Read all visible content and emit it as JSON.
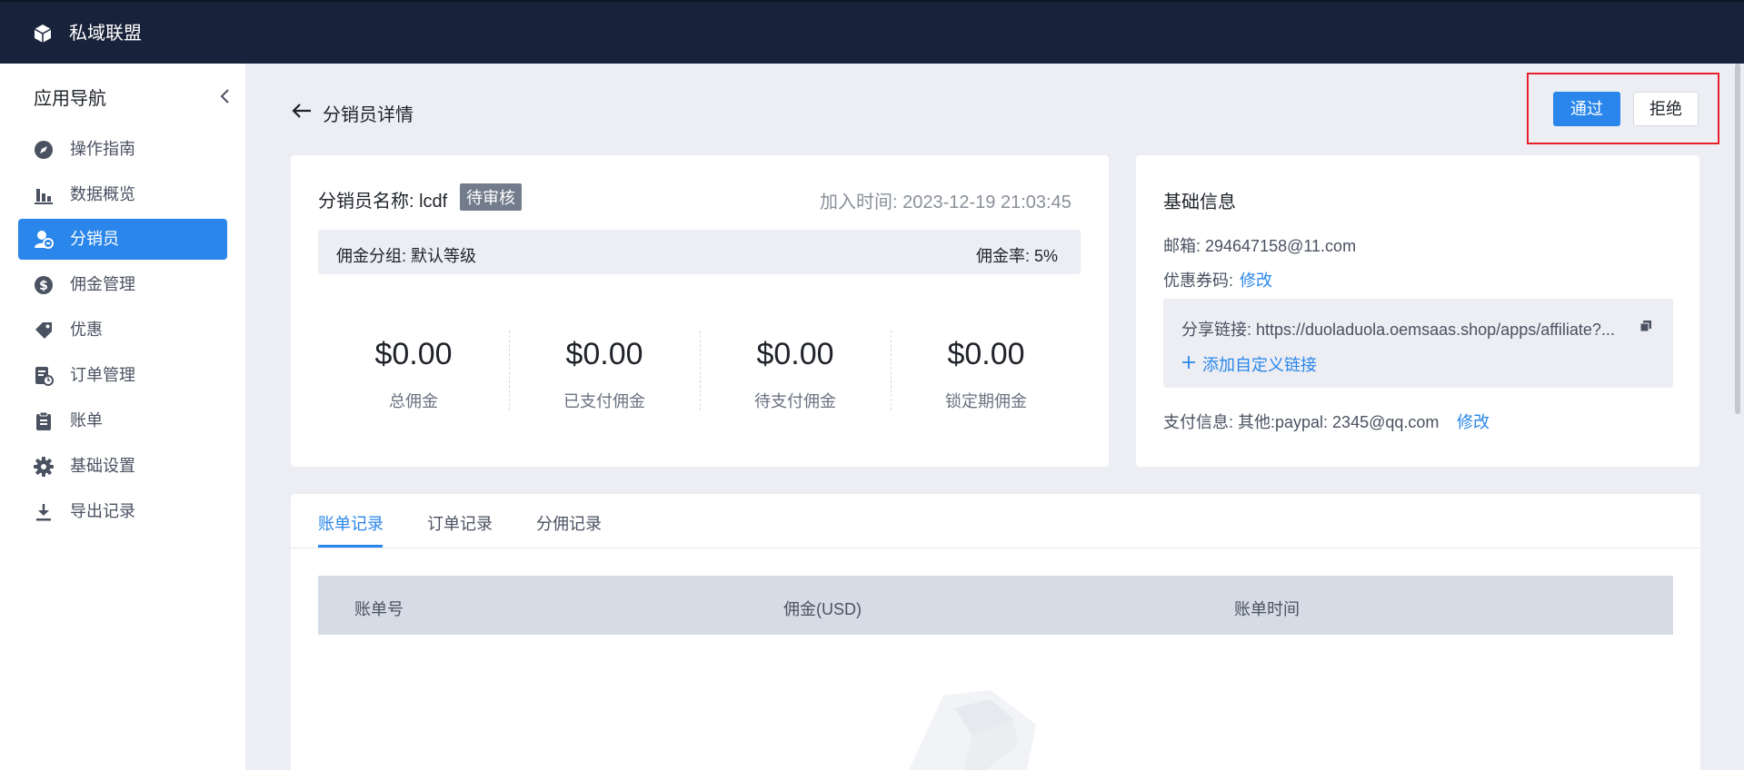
{
  "header": {
    "app_title": "私域联盟",
    "logo_icon": "cube-icon"
  },
  "sidebar": {
    "title": "应用导航",
    "collapse_icon": "chevron-left-icon",
    "items": [
      {
        "label": "操作指南",
        "icon": "compass-icon"
      },
      {
        "label": "数据概览",
        "icon": "bar-chart-icon"
      },
      {
        "label": "分销员",
        "icon": "user-group-icon",
        "active": true
      },
      {
        "label": "佣金管理",
        "icon": "dollar-circle-icon"
      },
      {
        "label": "优惠",
        "icon": "tag-icon"
      },
      {
        "label": "订单管理",
        "icon": "order-icon"
      },
      {
        "label": "账单",
        "icon": "clipboard-icon"
      },
      {
        "label": "基础设置",
        "icon": "gear-icon"
      },
      {
        "label": "导出记录",
        "icon": "download-icon"
      }
    ]
  },
  "page": {
    "title": "分销员详情",
    "approve_label": "通过",
    "reject_label": "拒绝"
  },
  "affiliate": {
    "name_label": "分销员名称: lcdf",
    "status_badge": "待审核",
    "join_time": "加入时间: 2023-12-19 21:03:45",
    "group_label": "佣金分组: 默认等级",
    "rate_label": "佣金率: 5%",
    "stats": [
      {
        "value": "$0.00",
        "label": "总佣金"
      },
      {
        "value": "$0.00",
        "label": "已支付佣金"
      },
      {
        "value": "$0.00",
        "label": "待支付佣金"
      },
      {
        "value": "$0.00",
        "label": "锁定期佣金"
      }
    ]
  },
  "basic_info": {
    "title": "基础信息",
    "email": "邮箱: 294647158@11.com",
    "coupon_label": "优惠券码:",
    "coupon_edit": "修改",
    "share_link": "分享链接: https://duoladuola.oemsaas.shop/apps/affiliate?...",
    "add_custom_link": "添加自定义链接",
    "payment_info": "支付信息: 其他:paypal: 2345@qq.com",
    "payment_edit": "修改"
  },
  "records": {
    "tabs": [
      {
        "label": "账单记录",
        "active": true
      },
      {
        "label": "订单记录"
      },
      {
        "label": "分佣记录"
      }
    ],
    "columns": [
      "账单号",
      "佣金(USD)",
      "账单时间"
    ],
    "rows": []
  },
  "colors": {
    "primary": "#2a86ea",
    "topbar": "#18223a",
    "highlight": "#e8202b"
  }
}
